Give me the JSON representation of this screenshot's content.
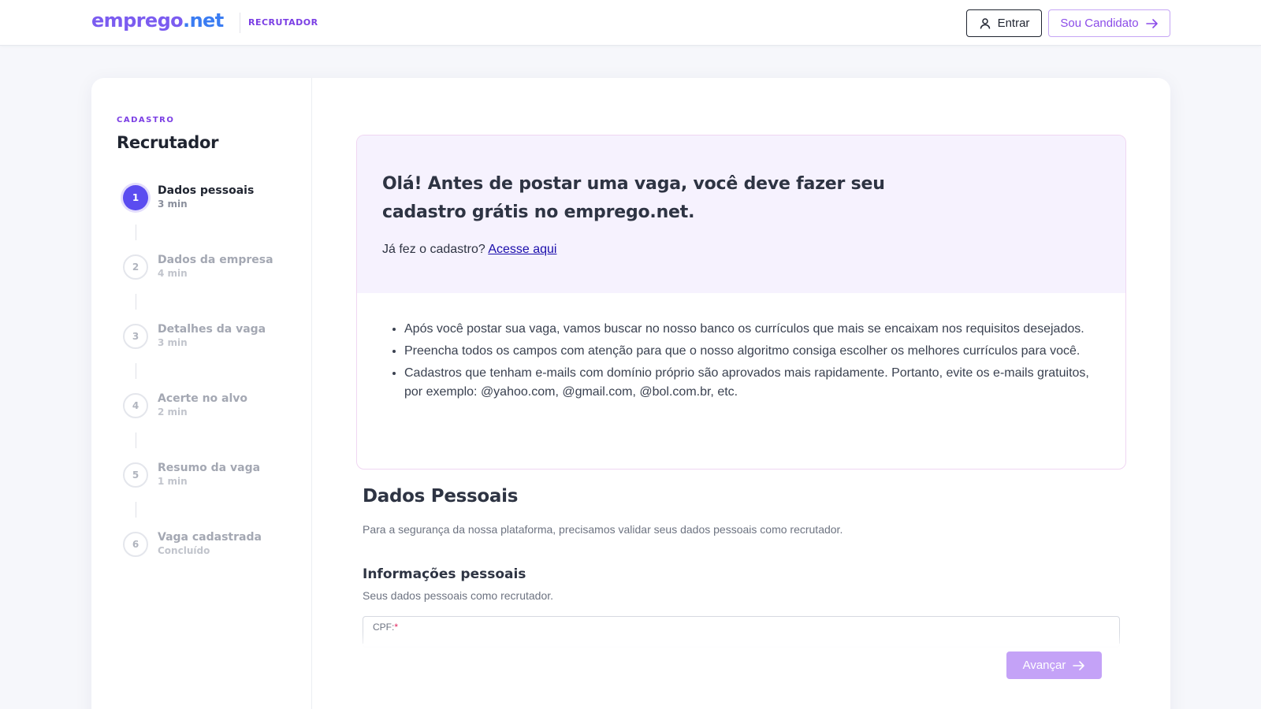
{
  "header": {
    "logo_part1": "emprego",
    "logo_part2": ".net",
    "role_label": "RECRUTADOR",
    "login_label": "Entrar",
    "candidate_label": "Sou Candidato"
  },
  "sidebar": {
    "kicker": "CADASTRO",
    "title": "Recrutador",
    "steps": [
      {
        "number": "1",
        "name": "Dados pessoais",
        "time": "3 min",
        "state": "active"
      },
      {
        "number": "2",
        "name": "Dados da empresa",
        "time": "4 min",
        "state": "inactive"
      },
      {
        "number": "3",
        "name": "Detalhes da vaga",
        "time": "3 min",
        "state": "inactive"
      },
      {
        "number": "4",
        "name": "Acerte no alvo",
        "time": "2 min",
        "state": "inactive"
      },
      {
        "number": "5",
        "name": "Resumo da vaga",
        "time": "1 min",
        "state": "inactive"
      },
      {
        "number": "6",
        "name": "Vaga cadastrada",
        "time": "Concluído",
        "state": "inactive"
      }
    ]
  },
  "intro": {
    "heading": "Olá! Antes de postar uma vaga, você deve fazer seu cadastro grátis no emprego.net.",
    "login_prompt": "Já fez o cadastro?",
    "login_link": "Acesse aqui",
    "bullets": [
      "Após você postar sua vaga, vamos buscar no nosso banco os currículos que mais se encaixam nos requisitos desejados.",
      "Preencha todos os campos com atenção para que o nosso algoritmo consiga escolher os melhores currículos para você.",
      "Cadastros que tenham e-mails com domínio próprio são aprovados mais rapidamente. Portanto, evite os e-mails gratuitos, por exemplo: @yahoo.com, @gmail.com, @bol.com.br, etc."
    ]
  },
  "form": {
    "section_title": "Dados Pessoais",
    "section_subtitle": "Para a segurança da nossa plataforma, precisamos validar seus dados pessoais como recrutador.",
    "subsection_title": "Informações pessoais",
    "subsection_subtitle": "Seus dados pessoais como recrutador.",
    "cpf_label": "CPF:",
    "required_mark": "*"
  },
  "footer": {
    "next_label": "Avançar"
  },
  "colors": {
    "brand_purple": "#7b5cf0",
    "brand_blue": "#3a7cf2",
    "active_step": "#5b4cf0",
    "next_button": "#c4a2f7"
  }
}
